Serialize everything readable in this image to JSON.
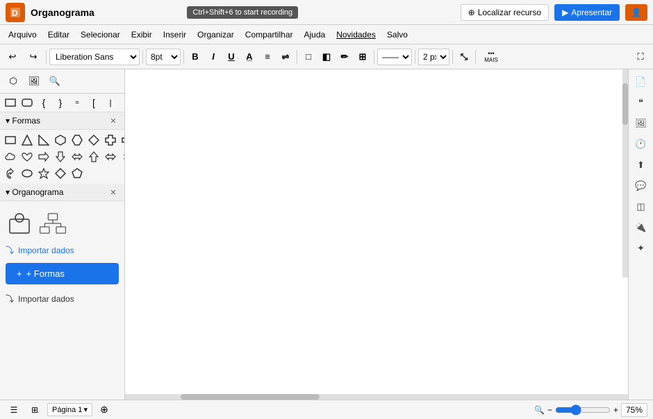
{
  "titlebar": {
    "app_name": "Organograma",
    "recording_tooltip": "Ctrl+Shift+6 to start recording",
    "locate_btn": "Localizar recurso",
    "present_btn": "Apresentar",
    "user_btn": ""
  },
  "menubar": {
    "items": [
      "Arquivo",
      "Editar",
      "Selecionar",
      "Exibir",
      "Inserir",
      "Organizar",
      "Compartilhar",
      "Ajuda",
      "Novidades",
      "Salvo"
    ]
  },
  "toolbar": {
    "font_name": "Liberation Sans",
    "font_size": "8pt",
    "bold": "B",
    "italic": "I",
    "underline": "U",
    "font_color": "A",
    "align": "≡",
    "more_label": "MAIS",
    "line_style": "——",
    "line_width": "2 px",
    "transform": "⤡"
  },
  "left_panel": {
    "search_placeholder": "Pesquisar",
    "shapes_section": "Formas",
    "orgchart_section": "Organograma",
    "import_label": "Importar dados",
    "add_shapes_label": "+ Formas",
    "import_bottom_label": "Importar dados"
  },
  "right_panel": {
    "icons": [
      "page",
      "quote",
      "layers",
      "history",
      "export",
      "comment",
      "stack",
      "plugin",
      "cursor"
    ]
  },
  "statusbar": {
    "page_label": "Página 1",
    "zoom_level": "75%",
    "zoom_range": 75
  }
}
